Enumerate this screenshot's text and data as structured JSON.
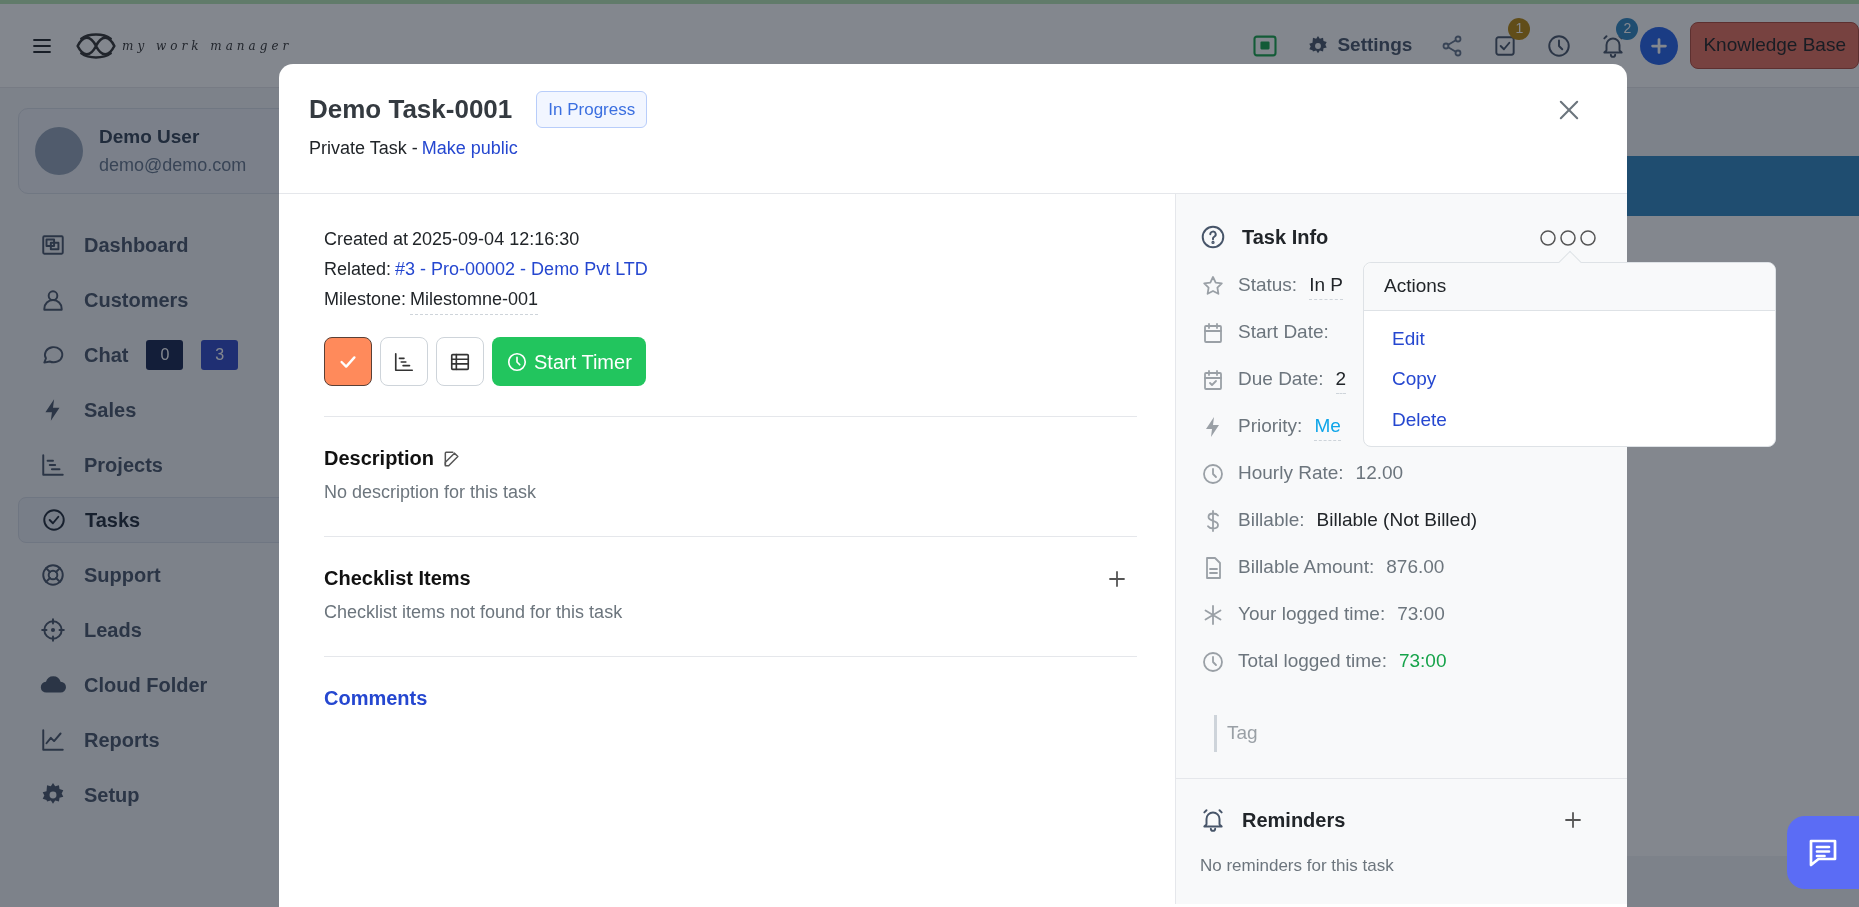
{
  "navbar": {
    "logo_text": "my work manager",
    "settings_label": "Settings",
    "tasks_badge": "1",
    "notifications_badge": "2",
    "knowledge_base_button": "Knowledge Base"
  },
  "sidebar": {
    "user": {
      "name": "Demo User",
      "email": "demo@demo.com"
    },
    "items": [
      {
        "label": "Dashboard",
        "selected": false
      },
      {
        "label": "Customers",
        "selected": false
      },
      {
        "label": "Chat",
        "selected": false,
        "badges": [
          {
            "text": "0",
            "kind": "secondary"
          },
          {
            "text": "3",
            "kind": "primary"
          }
        ]
      },
      {
        "label": "Sales",
        "selected": false
      },
      {
        "label": "Projects",
        "selected": false
      },
      {
        "label": "Tasks",
        "selected": true
      },
      {
        "label": "Support",
        "selected": false
      },
      {
        "label": "Leads",
        "selected": false
      },
      {
        "label": "Cloud Folder",
        "selected": false
      },
      {
        "label": "Reports",
        "selected": false
      },
      {
        "label": "Setup",
        "selected": false
      }
    ]
  },
  "modal": {
    "title": "Demo Task-0001",
    "status_badge": "In Progress",
    "visibility_text": "Private Task -",
    "visibility_link": "Make public",
    "meta": [
      {
        "label": "Created at",
        "value": "2025-09-04 12:16:30",
        "kind": "plain"
      },
      {
        "label": "Related:",
        "value": "#3 - Pro-00002 - Demo Pvt LTD",
        "kind": "link"
      },
      {
        "label": "Milestone:",
        "value": "Milestomne-001",
        "kind": "editable"
      }
    ],
    "actions": [
      {
        "kind": "complete"
      },
      {
        "kind": "chart"
      },
      {
        "kind": "table"
      },
      {
        "kind": "timer",
        "label": "Start Timer"
      }
    ],
    "sections": [
      {
        "kind": "editable",
        "title": "Description",
        "text": "No description for this task"
      },
      {
        "kind": "addable",
        "title": "Checklist Items",
        "text": "Checklist items not found for this task"
      },
      {
        "kind": "link",
        "title": "Comments"
      }
    ],
    "task_info": {
      "title": "Task Info",
      "rows": [
        {
          "label": "Status:",
          "value": "In P",
          "kind": "editable"
        },
        {
          "label": "Start Date:"
        },
        {
          "label": "Due Date:",
          "value": "2",
          "kind": "editable"
        },
        {
          "label": "Priority:",
          "value": "Me",
          "kind": "editable-info"
        },
        {
          "label": "Hourly Rate:",
          "value": "12.00",
          "kind": "muted"
        },
        {
          "label": "Billable:",
          "value": "Billable (Not Billed)",
          "kind": "plain"
        },
        {
          "label": "Billable Amount:",
          "value": "876.00",
          "kind": "muted"
        },
        {
          "label": "Your logged time:",
          "value": "73:00",
          "kind": "muted"
        },
        {
          "label": "Total logged time:",
          "value": "73:00",
          "kind": "success"
        }
      ],
      "tag_placeholder": "Tag"
    },
    "actions_menu": {
      "title": "Actions",
      "items": [
        "Edit",
        "Copy",
        "Delete"
      ]
    },
    "reminders": {
      "title": "Reminders",
      "empty_text": "No reminders for this task"
    }
  }
}
